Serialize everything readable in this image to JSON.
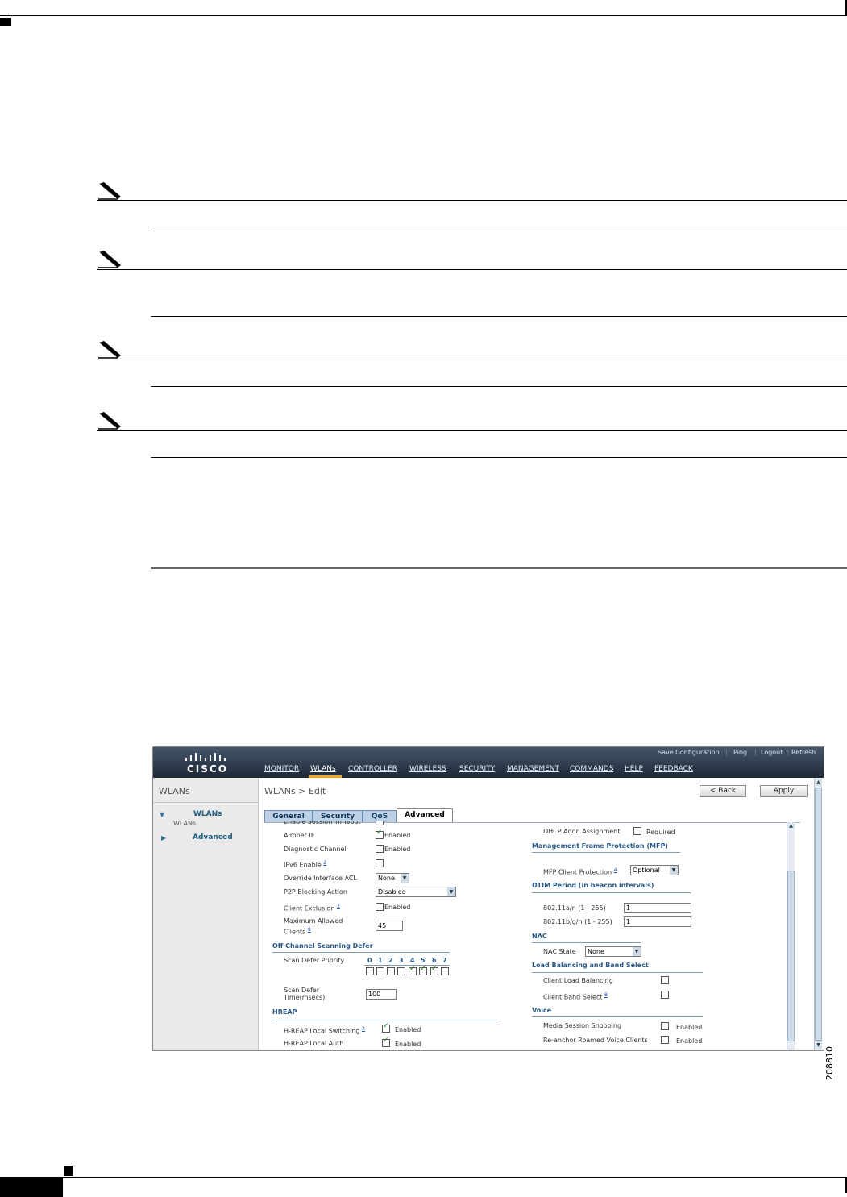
{
  "figure": {
    "id_label": "208810",
    "app": {
      "logo": "CISCO",
      "utility_links": [
        "Save Configuration",
        "Ping",
        "Logout",
        "Refresh"
      ],
      "nav": [
        "MONITOR",
        "WLANs",
        "CONTROLLER",
        "WIRELESS",
        "SECURITY",
        "MANAGEMENT",
        "COMMANDS",
        "HELP",
        "FEEDBACK"
      ],
      "active_nav": "WLANs"
    },
    "sidebar": {
      "title": "WLANs",
      "items": [
        {
          "label": "WLANs",
          "sub": "WLANs",
          "expanded": true
        },
        {
          "label": "Advanced",
          "expanded": false
        }
      ]
    },
    "main": {
      "title": "WLANs > Edit",
      "buttons": {
        "back": "< Back",
        "apply": "Apply"
      },
      "tabs": [
        "General",
        "Security",
        "QoS",
        "Advanced"
      ],
      "active_tab": "Advanced",
      "left": {
        "clipped_label": "Enable Session Timeout",
        "aironet_ie": {
          "label": "Aironet IE",
          "checked": true,
          "text": "Enabled"
        },
        "diagnostic_channel": {
          "label": "Diagnostic Channel",
          "checked": false,
          "text": "Enabled"
        },
        "ipv6_enable": {
          "label": "IPv6 Enable",
          "footnote": "2",
          "checked": false
        },
        "override_acl": {
          "label": "Override Interface ACL",
          "value": "None"
        },
        "p2p_blocking": {
          "label": "P2P Blocking Action",
          "value": "Disabled"
        },
        "client_exclusion": {
          "label": "Client Exclusion",
          "footnote": "3",
          "checked": false,
          "text": "Enabled"
        },
        "max_clients": {
          "label_1": "Maximum Allowed",
          "label_2": "Clients",
          "footnote": "8",
          "value": "45"
        },
        "off_channel_title": "Off Channel Scanning Defer",
        "scan_defer_priority": {
          "label": "Scan Defer Priority",
          "priorities": [
            "0",
            "1",
            "2",
            "3",
            "4",
            "5",
            "6",
            "7"
          ],
          "checked": [
            false,
            false,
            false,
            false,
            true,
            true,
            true,
            false
          ]
        },
        "scan_defer_time": {
          "label_1": "Scan Defer",
          "label_2": "Time(msecs)",
          "value": "100"
        },
        "hreap_title": "HREAP",
        "hreap_local_switching": {
          "label": "H-REAP Local Switching",
          "footnote": "2",
          "checked": true,
          "text": "Enabled"
        },
        "hreap_local_auth": {
          "label": "H-REAP Local Auth",
          "checked": true,
          "text": "Enabled"
        }
      },
      "right": {
        "dhcp_addr": {
          "label": "DHCP Addr. Assignment",
          "checked": false,
          "text": "Required"
        },
        "mfp_title": "Management Frame Protection (MFP)",
        "mfp_client": {
          "label": "MFP Client Protection",
          "footnote": "4",
          "value": "Optional"
        },
        "dtim_title": "DTIM Period (in beacon intervals)",
        "dtim_a": {
          "label": "802.11a/n (1 - 255)",
          "value": "1"
        },
        "dtim_bg": {
          "label": "802.11b/g/n (1 - 255)",
          "value": "1"
        },
        "nac_title": "NAC",
        "nac_state": {
          "label": "NAC State",
          "value": "None"
        },
        "lb_title": "Load Balancing and Band Select",
        "client_lb": {
          "label": "Client Load Balancing",
          "checked": false
        },
        "client_band": {
          "label": "Client Band Select",
          "footnote": "8",
          "checked": false
        },
        "voice_title": "Voice",
        "media_snoop": {
          "label": "Media Session Snooping",
          "checked": false,
          "text": "Enabled"
        },
        "reanchor": {
          "label": "Re-anchor Roamed Voice Clients",
          "checked": false,
          "text": "Enabled"
        }
      }
    }
  }
}
